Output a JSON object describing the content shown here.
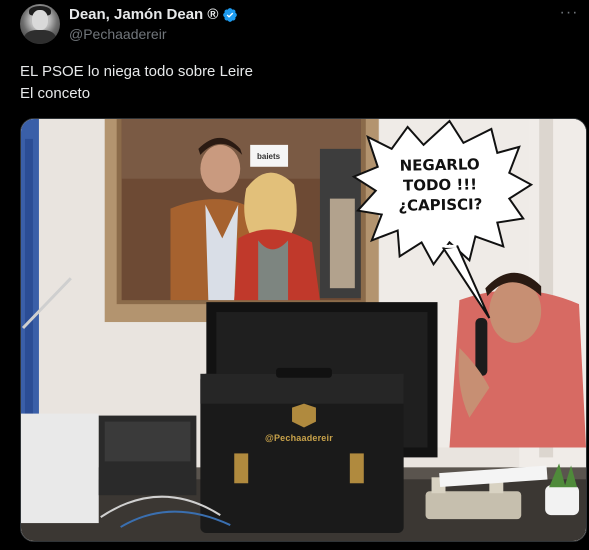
{
  "author": {
    "display_name": "Dean, Jamón Dean ®",
    "handle": "@Pechaadereir",
    "verified_color": "#1d9bf0",
    "avatar_icon": "avatar-icon"
  },
  "menu": {
    "more_label": "···"
  },
  "tweet": {
    "lines": [
      "EL PSOE lo niega todo sobre Leire",
      "El conceto"
    ]
  },
  "media": {
    "speech_bubble": [
      "NEGARLO",
      "TODO !!!",
      "¿CAPISCI?"
    ],
    "watermark": "@Pechaadereir",
    "sign": "baiets"
  },
  "colors": {
    "background": "#000000",
    "text_primary": "#e7e9ea",
    "text_secondary": "#71767b",
    "border": "#2f3336"
  }
}
